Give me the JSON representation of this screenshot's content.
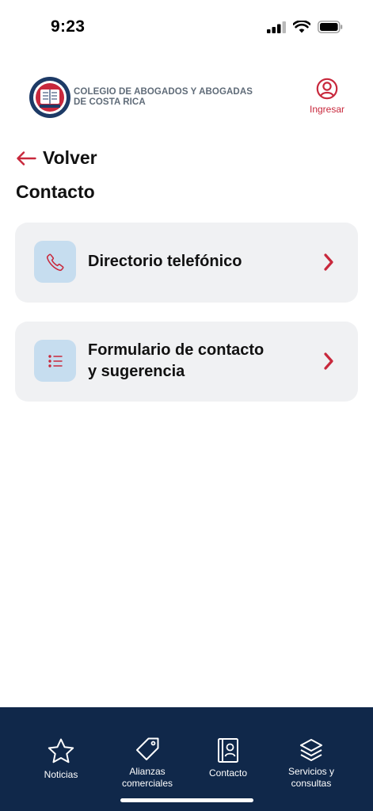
{
  "status_bar": {
    "time": "9:23"
  },
  "header": {
    "org_name": "COLEGIO DE ABOGADOS Y ABOGADAS\nDE COSTA RICA",
    "login_label": "Ingresar"
  },
  "nav": {
    "back_label": "Volver"
  },
  "page": {
    "title": "Contacto"
  },
  "cards": [
    {
      "label": "Directorio telefónico",
      "icon": "phone-icon"
    },
    {
      "label": "Formulario de contacto\ny sugerencia",
      "icon": "list-icon"
    }
  ],
  "tabbar": {
    "items": [
      {
        "label": "Noticias",
        "icon": "star-icon"
      },
      {
        "label": "Alianzas\ncomerciales",
        "icon": "tag-icon"
      },
      {
        "label": "Contacto",
        "icon": "contact-book-icon"
      },
      {
        "label": "Servicios y\nconsultas",
        "icon": "layers-icon"
      }
    ]
  },
  "colors": {
    "accent": "#c8283c",
    "navy": "#10284a",
    "card_bg": "#f0f1f3",
    "icon_bg": "#c6ddef",
    "org_text": "#5f6b78"
  }
}
